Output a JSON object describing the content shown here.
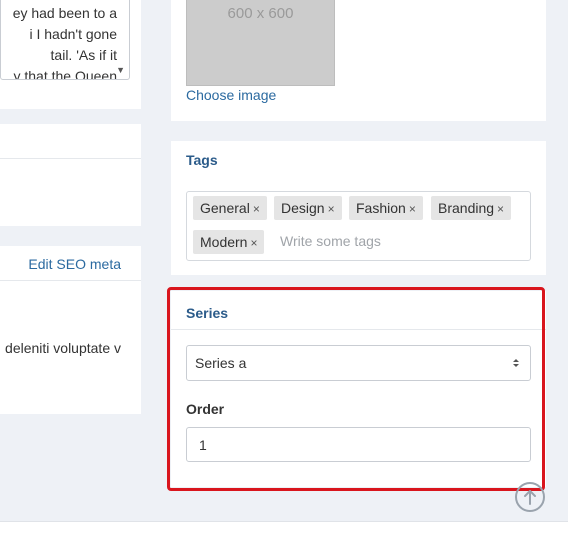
{
  "content": {
    "description_lines": [
      "ey had been to a",
      "i I hadn't gone",
      "tail. 'As if it",
      "y that the Queen"
    ]
  },
  "seo": {
    "edit_link": "Edit SEO meta",
    "description_fragment": "deleniti voluptate v"
  },
  "image": {
    "placeholder_label": "600 x 600",
    "choose_label": "Choose image"
  },
  "tags": {
    "title": "Tags",
    "items": [
      "General",
      "Design",
      "Fashion",
      "Branding",
      "Modern"
    ],
    "remove_glyph": "×",
    "input_placeholder": "Write some tags"
  },
  "series": {
    "title": "Series",
    "selected": "Series a",
    "order_label": "Order",
    "order_value": "1"
  },
  "colors": {
    "link": "#2b6aa0",
    "panel_title": "#2b5b8a",
    "highlight": "#d9151d",
    "background": "#eef1f6"
  }
}
